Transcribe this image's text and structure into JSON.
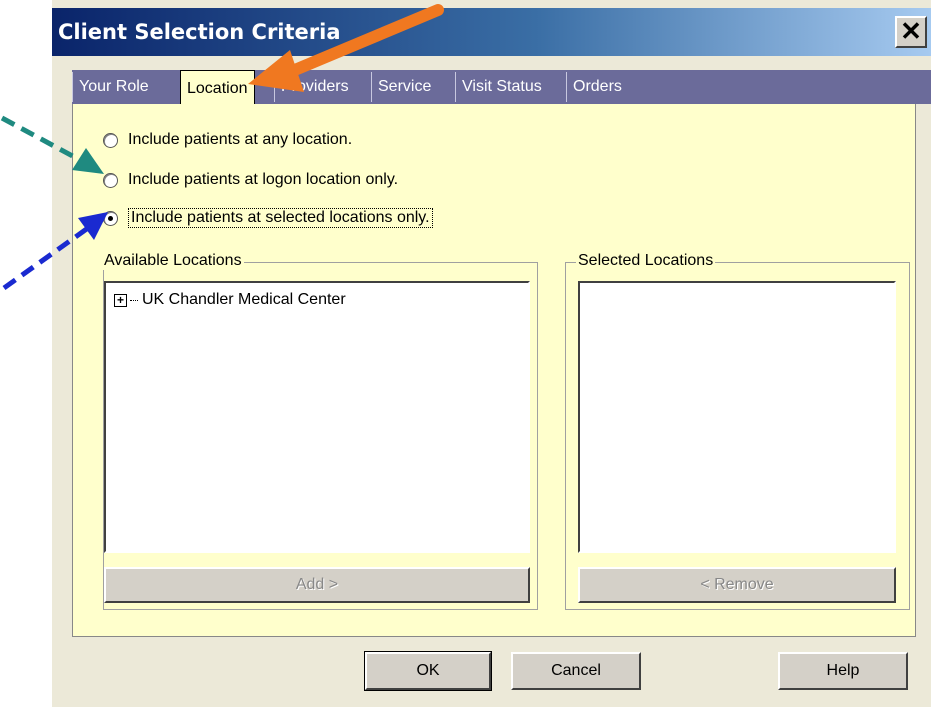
{
  "window": {
    "title": "Client Selection Criteria",
    "close_label": "✕"
  },
  "tabs": [
    {
      "label": "Your Role",
      "active": false
    },
    {
      "label": "Location",
      "active": true
    },
    {
      "label": "Providers",
      "active": false
    },
    {
      "label": "Service",
      "active": false
    },
    {
      "label": "Visit Status",
      "active": false
    },
    {
      "label": "Orders",
      "active": false
    }
  ],
  "location_options": [
    {
      "label": "Include patients at any location.",
      "checked": false
    },
    {
      "label": "Include patients at logon location only.",
      "checked": false
    },
    {
      "label": "Include patients at selected locations only.",
      "checked": true
    }
  ],
  "available": {
    "legend": "Available Locations",
    "items": [
      "UK Chandler Medical Center"
    ],
    "add_label": "Add >"
  },
  "selected": {
    "legend": "Selected Locations",
    "items": [],
    "remove_label": "< Remove"
  },
  "buttons": {
    "ok": "OK",
    "cancel": "Cancel",
    "help": "Help"
  },
  "annotation_colors": {
    "orange_arrow": "#f07820",
    "teal_arrow": "#1f8a80",
    "blue_arrow": "#1a2ad0"
  },
  "colors": {
    "panel_bg": "#ffffcc",
    "tabstrip_bg": "#6b6b9a",
    "title_gradient_start": "#0a246a"
  }
}
